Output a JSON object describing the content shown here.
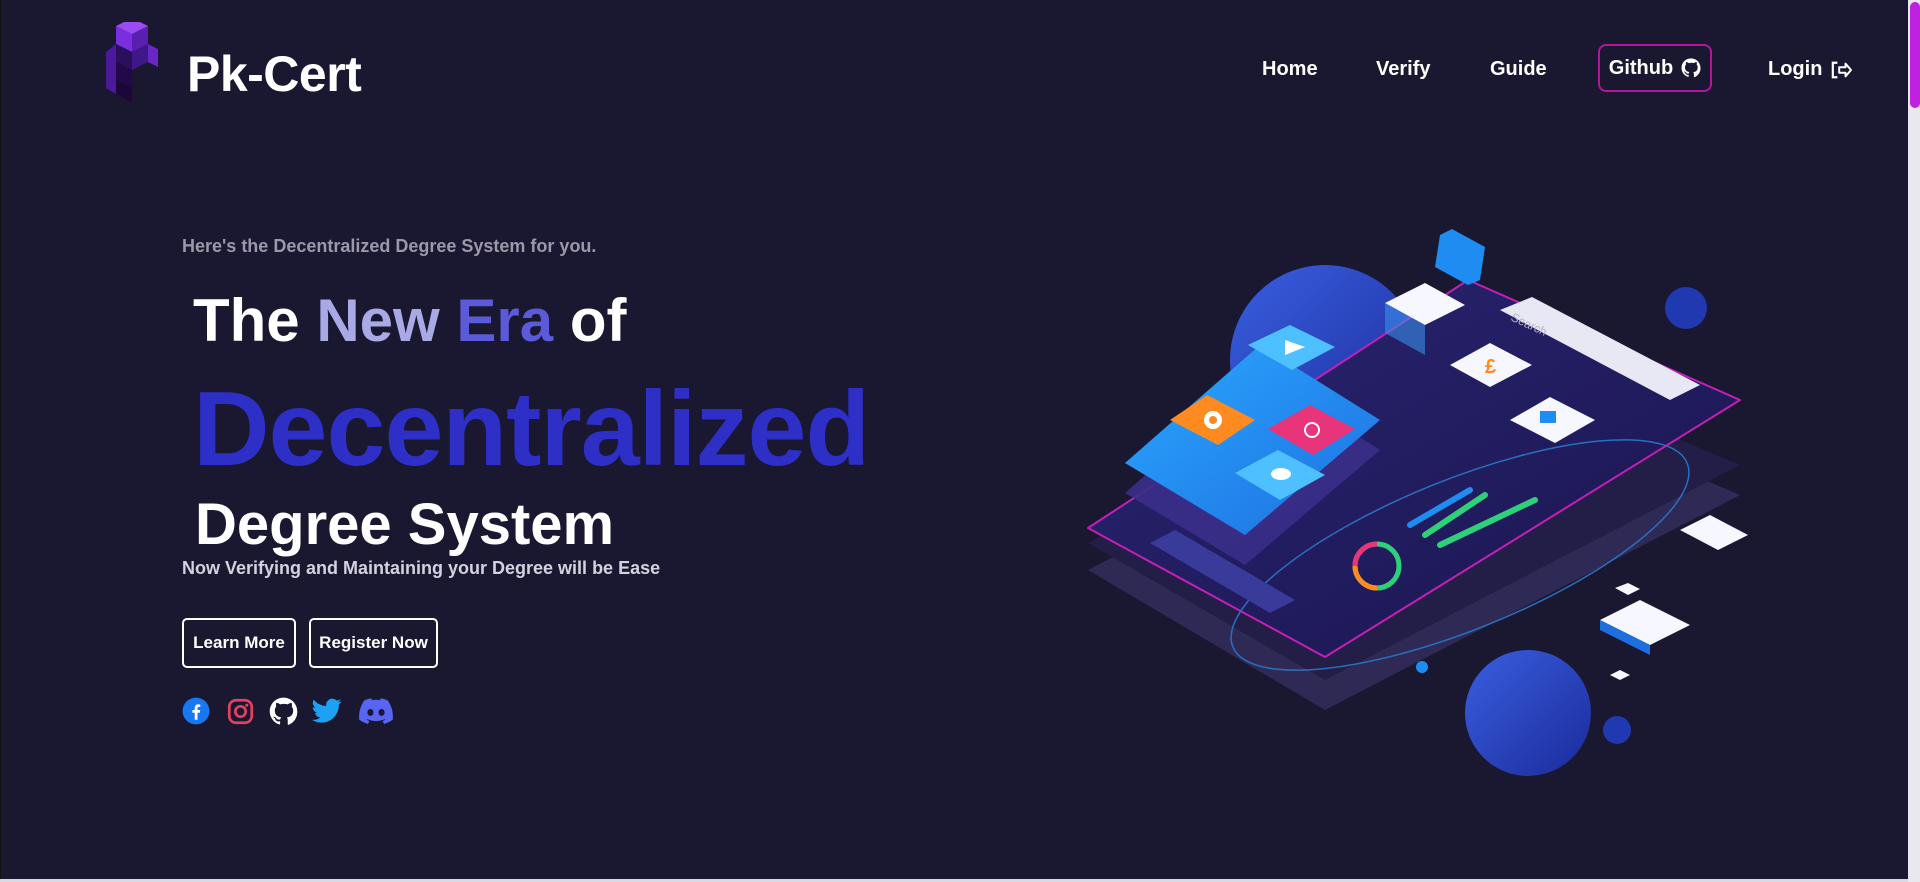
{
  "header": {
    "brand": "Pk-Cert",
    "nav": [
      {
        "label": "Home"
      },
      {
        "label": "Verify"
      },
      {
        "label": "Guide"
      },
      {
        "label": "Github",
        "icon": "github-icon"
      },
      {
        "label": "Login",
        "icon": "sign-in-icon"
      }
    ]
  },
  "hero": {
    "tagline": "Here's the Decentralized Degree System for you.",
    "line1": {
      "the": "The",
      "new": "New",
      "era": "Era",
      "of": "of"
    },
    "line2": "Decentralized",
    "line3": "Degree System",
    "subline": "Now Verifying and Maintaining your Degree will be Ease",
    "buttons": {
      "learn_more": "Learn More",
      "register": "Register Now"
    },
    "social": [
      {
        "icon": "facebook-icon",
        "color": "#1877f2"
      },
      {
        "icon": "instagram-icon",
        "color": "#e4405f"
      },
      {
        "icon": "github-icon",
        "color": "#ffffff"
      },
      {
        "icon": "twitter-icon",
        "color": "#1da1f2"
      },
      {
        "icon": "discord-icon",
        "color": "#5865f2"
      }
    ]
  },
  "illustration": {
    "search_placeholder": "Search"
  },
  "colors": {
    "background": "#1a1730",
    "accent_blue": "#2e2fc6",
    "github_border": "#b3159c",
    "scroll_thumb": "#c020e0"
  }
}
